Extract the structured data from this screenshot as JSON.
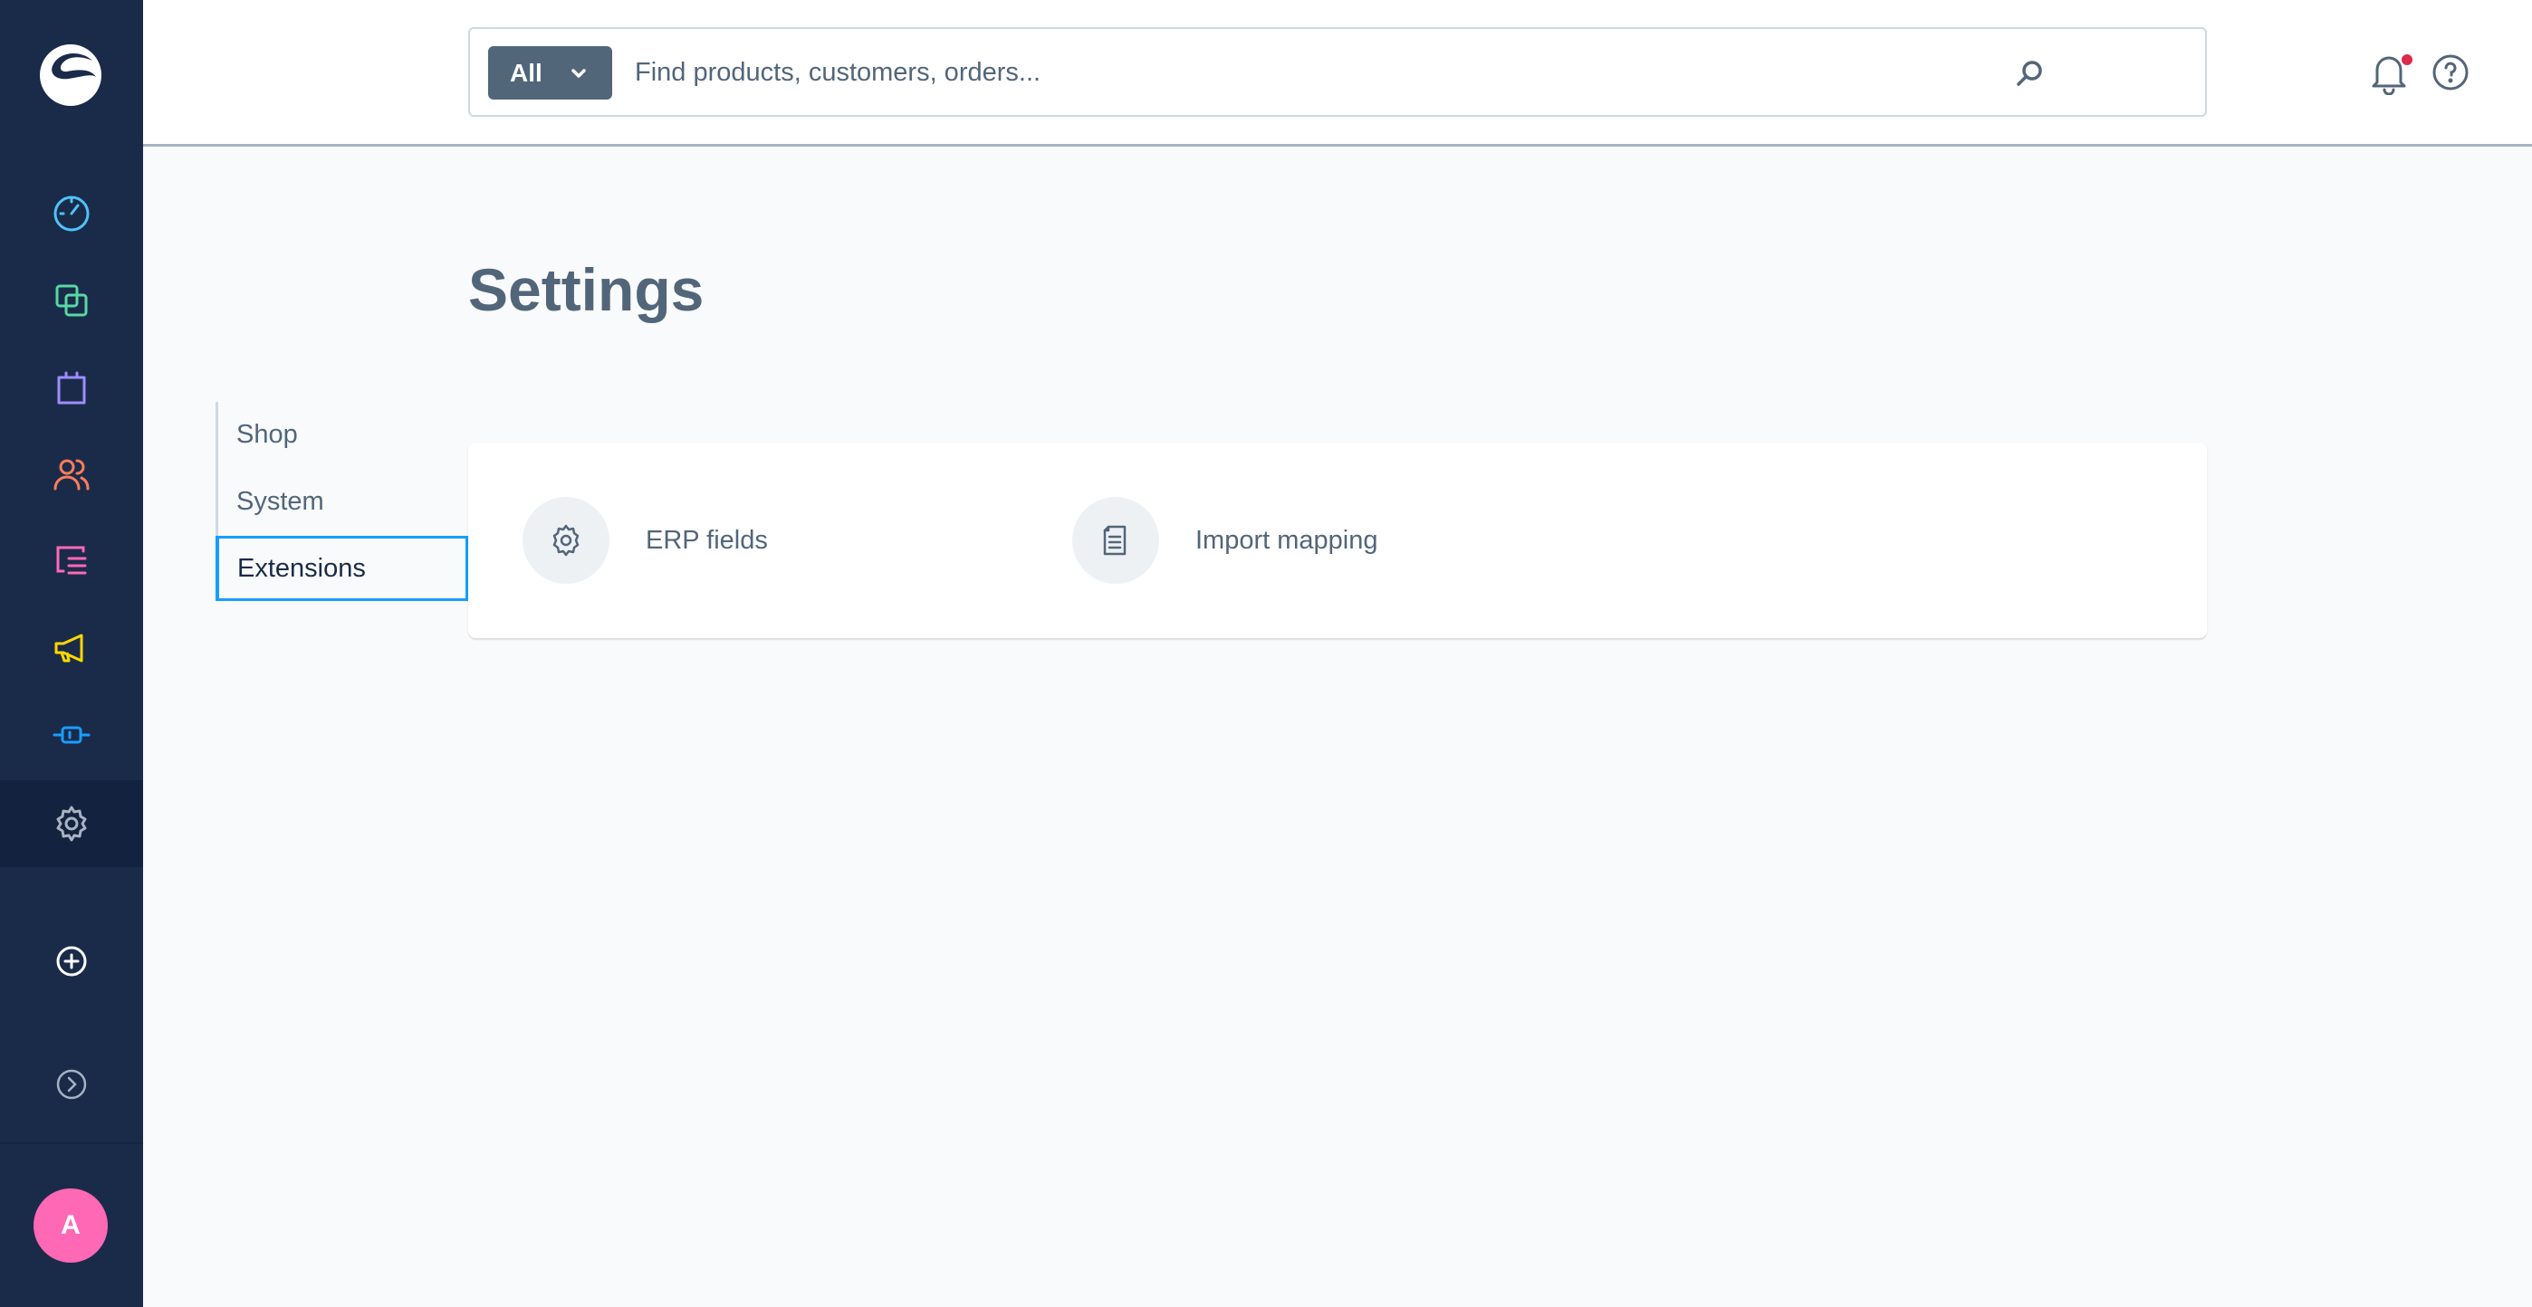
{
  "search": {
    "type_label": "All",
    "placeholder": "Find products, customers, orders..."
  },
  "page": {
    "title": "Settings"
  },
  "settings_nav": [
    {
      "label": "Shop",
      "active": false
    },
    {
      "label": "System",
      "active": false
    },
    {
      "label": "Extensions",
      "active": true
    }
  ],
  "extensions": [
    {
      "label": "ERP fields",
      "icon": "gear-icon"
    },
    {
      "label": "Import mapping",
      "icon": "document-icon"
    }
  ],
  "user": {
    "avatar_initial": "A"
  },
  "colors": {
    "sidebar": "#1a2b4a",
    "accent": "#189eff",
    "text": "#52667a",
    "notification": "#de294c",
    "avatar": "#ff68b4"
  }
}
